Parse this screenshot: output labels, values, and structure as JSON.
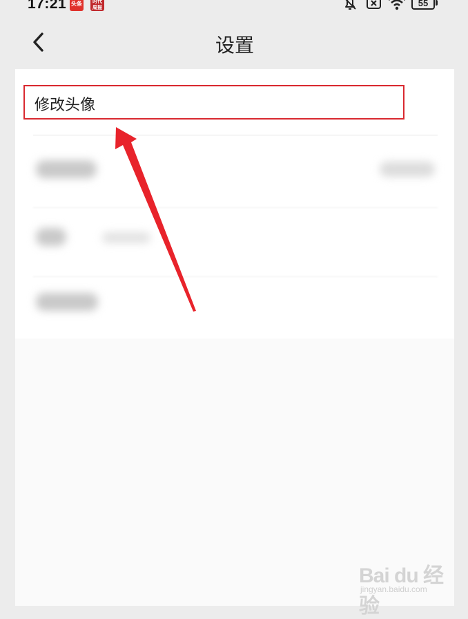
{
  "status_bar": {
    "time": "17:21",
    "badge_1": "头条",
    "badge_2": "时代周报",
    "battery": "55",
    "icons": [
      "bell-off-icon",
      "sim-off-icon",
      "wifi-icon",
      "battery-icon"
    ]
  },
  "header": {
    "title": "设置",
    "back_icon": "chevron-left-icon"
  },
  "settings": {
    "items": [
      {
        "label": "修改头像",
        "highlighted": true
      }
    ],
    "blurred_rows": 3
  },
  "annotation": {
    "color": "#e8232b",
    "type": "arrow"
  },
  "watermark": {
    "brand": "Bai du 经验",
    "url": "jingyan.baidu.com"
  },
  "colors": {
    "highlight_border": "#d9282f",
    "background": "#ececec",
    "panel": "#fafafa"
  }
}
